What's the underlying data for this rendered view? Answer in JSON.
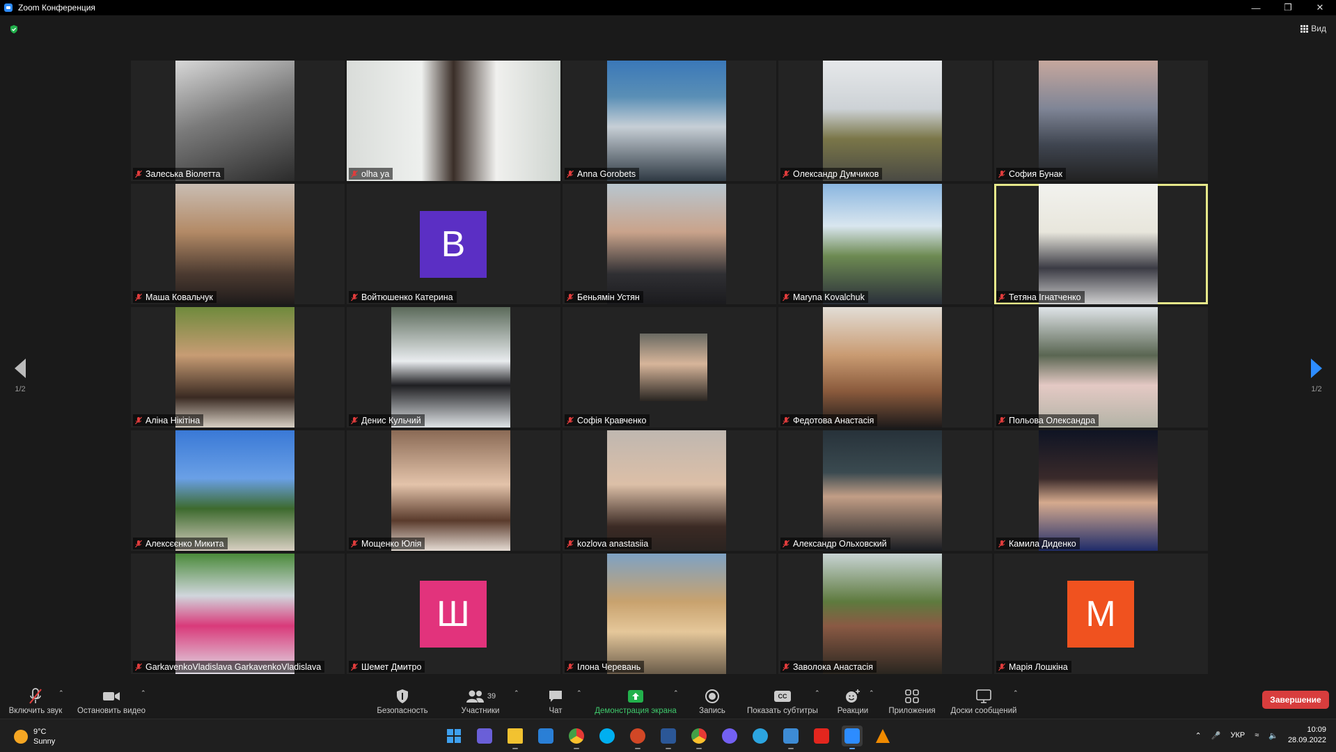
{
  "window": {
    "title": "Zoom Конференция"
  },
  "view_button": {
    "label": "Вид"
  },
  "pager": {
    "left": "1/2",
    "right": "1/2"
  },
  "participants": [
    {
      "name": "Залеська Віолетта",
      "kind": "photo",
      "bg": "linear-gradient(160deg,#d8d8d8 0%,#7a7a7a 45%,#2b2b2b 100%)"
    },
    {
      "name": "olha ya",
      "kind": "wide",
      "bg": "linear-gradient(90deg,#d9dcd9 0%,#eef0ee 35%,#3a2e28 50%,#f0f0ee 70%,#cfd5d0 100%)"
    },
    {
      "name": "Anna Gorobets",
      "kind": "photo",
      "bg": "linear-gradient(180deg,#3a78b8 0%,#5a8fb6 30%,#c7cfd6 55%,#2f3a44 100%)"
    },
    {
      "name": "Олександр Думчиков",
      "kind": "photo",
      "bg": "linear-gradient(180deg,#e6e8ea 0%,#cdd2d6 40%,#7a7648 65%,#4a4a44 100%)"
    },
    {
      "name": "София Бунак",
      "kind": "photo",
      "bg": "linear-gradient(180deg,#c6a79d 0%,#7f8596 40%,#3f4550 70%,#222 100%)"
    },
    {
      "name": "Маша Ковальчук",
      "kind": "photo",
      "bg": "linear-gradient(180deg,#c9bdb3 0%,#b38a66 40%,#4b3a30 75%,#1f1b1b 100%)"
    },
    {
      "name": "Войтюшенко Катерина",
      "kind": "avatar",
      "letter": "В",
      "color": "#5b2fc4"
    },
    {
      "name": "Беньямін Устян",
      "kind": "photo",
      "bg": "linear-gradient(180deg,#b8c6cf 0%,#c9a38b 40%,#2f2f33 75%,#1b1b1e 100%)"
    },
    {
      "name": "Maryna Kovalchuk",
      "kind": "photo",
      "bg": "linear-gradient(180deg,#8ab6e0 0%,#d9e6ef 35%,#6d8a52 60%,#2a2f3a 100%)"
    },
    {
      "name": "Тетяна Ігнатченко",
      "kind": "photo",
      "active": true,
      "bg": "linear-gradient(180deg,#f2f2ee 0%,#e8e6dc 40%,#3b3b44 70%,#cfcfcf 100%)"
    },
    {
      "name": "Аліна Нікітіна",
      "kind": "photo",
      "bg": "linear-gradient(180deg,#6f8a3c 0%,#c79c74 40%,#3a2a22 75%,#d8d0c4 100%)"
    },
    {
      "name": "Денис Кульчий",
      "kind": "photo",
      "bg": "linear-gradient(180deg,#5b6a5a 0%,#e9ecef 45%,#1f1f22 65%,#dfe3e6 100%)"
    },
    {
      "name": "Софія Кравченко",
      "kind": "small",
      "bg": "linear-gradient(180deg,#6a6a62 0%,#d7b59a 45%,#2a2622 100%)"
    },
    {
      "name": "Федотова Анастасія",
      "kind": "photo",
      "bg": "linear-gradient(180deg,#e2ddd6 0%,#c99b72 40%,#8a5a3c 70%,#1e1b1b 100%)"
    },
    {
      "name": "Польова Олександра",
      "kind": "photo",
      "bg": "linear-gradient(180deg,#dfe4e8 0%,#5a6652 40%,#e4c9c4 65%,#b3b3a6 100%)"
    },
    {
      "name": "Алексєєнко Микита",
      "kind": "photo",
      "bg": "linear-gradient(180deg,#3a79d6 0%,#6aa0e6 40%,#3d6a2e 65%,#d8cfc2 100%)"
    },
    {
      "name": "Мощенко Юлія",
      "kind": "photo",
      "bg": "linear-gradient(180deg,#8a6a55 0%,#e3c3aa 45%,#5a3b2c 75%,#e6dcd4 100%)"
    },
    {
      "name": "kozlova anastasiia",
      "kind": "photo",
      "bg": "linear-gradient(180deg,#bfb7b0 0%,#dcbfa7 45%,#3b2a24 80%,#2a2320 100%)"
    },
    {
      "name": "Александр Ольховский",
      "kind": "photo",
      "bg": "linear-gradient(180deg,#27323a 0%,#3a4a50 35%,#c29e86 55%,#1a1d22 100%)"
    },
    {
      "name": "Камила Диденко",
      "kind": "photo",
      "bg": "linear-gradient(180deg,#0f1424 0%,#3a2a2a 40%,#d5aa8e 60%,#1f2c6a 100%)"
    },
    {
      "name": "GarkavenkoVladislava GarkavenkoVladislava",
      "kind": "photo",
      "bg": "linear-gradient(180deg,#4a8a3a 0%,#d0d6dc 35%,#d93a7a 60%,#e0dde6 100%)"
    },
    {
      "name": "Шемет Дмитро",
      "kind": "avatar",
      "letter": "Ш",
      "color": "#e2337c"
    },
    {
      "name": "Ілона Черевань",
      "kind": "photo",
      "bg": "linear-gradient(180deg,#7ea2c4 0%,#c8a26e 40%,#e5c79a 65%,#6a5c4a 100%)"
    },
    {
      "name": "Заволока Анастасія",
      "kind": "photo",
      "bg": "linear-gradient(180deg,#c8d4d4 0%,#5e7a3e 40%,#8a5a44 60%,#2a2620 100%)"
    },
    {
      "name": "Марія Лошкіна",
      "kind": "avatar",
      "letter": "М",
      "color": "#f0521f"
    }
  ],
  "toolbar": {
    "mute": "Включить звук",
    "video": "Остановить видео",
    "security": "Безопасность",
    "participants": "Участники",
    "participants_count": "39",
    "chat": "Чат",
    "share": "Демонстрация экрана",
    "record": "Запись",
    "captions": "Показать субтитры",
    "reactions": "Реакции",
    "apps": "Приложения",
    "whiteboards": "Доски сообщений",
    "end": "Завершение",
    "cc_icon_text": "CC"
  },
  "taskbar": {
    "temperature": "9°C",
    "weather": "Sunny",
    "lang": "УКР",
    "time": "10:09",
    "date": "28.09.2022"
  }
}
